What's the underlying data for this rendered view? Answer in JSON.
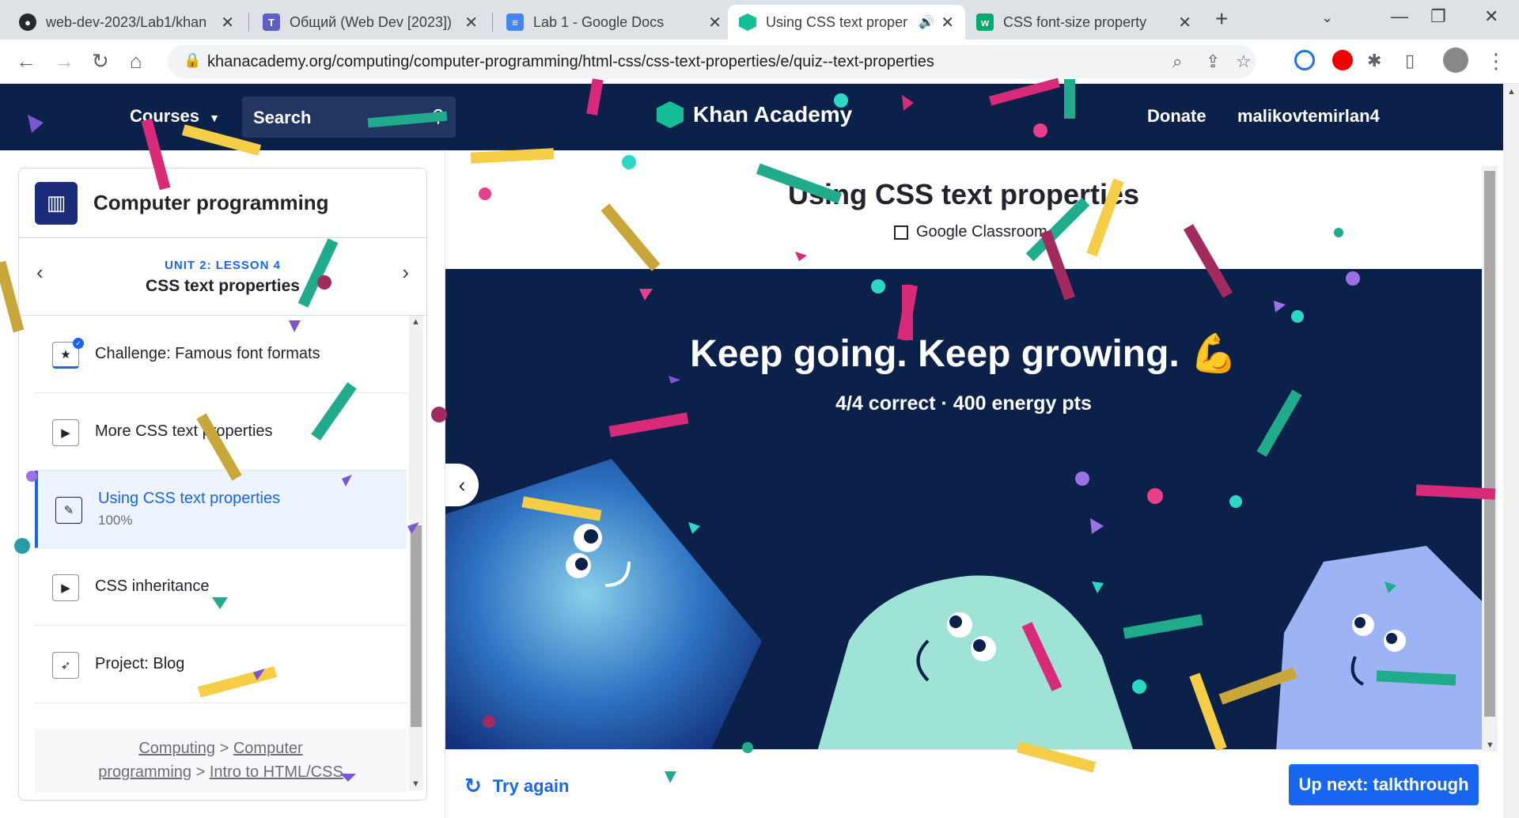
{
  "browser": {
    "tabs": [
      {
        "title": "web-dev-2023/Lab1/khan",
        "icon": "github-icon"
      },
      {
        "title": "Общий (Web Dev [2023])",
        "icon": "teams-icon"
      },
      {
        "title": "Lab 1 - Google Docs",
        "icon": "docs-icon"
      },
      {
        "title": "Using CSS text proper",
        "icon": "khan-icon",
        "active": true
      },
      {
        "title": "CSS font-size property",
        "icon": "w3schools-icon"
      }
    ],
    "url": "khanacademy.org/computing/computer-programming/html-css/css-text-properties/e/quiz--text-properties"
  },
  "header": {
    "courses_label": "Courses",
    "search_label": "Search",
    "logo_text": "Khan Academy",
    "donate_label": "Donate",
    "username": "malikovtemirlan4"
  },
  "sidebar": {
    "course_title": "Computer programming",
    "unit_label": "UNIT 2: LESSON 4",
    "lesson_title": "CSS text properties",
    "items": [
      {
        "label": "Challenge: Famous font formats",
        "type": "challenge",
        "completed": true
      },
      {
        "label": "More CSS text properties",
        "type": "video"
      },
      {
        "label": "Using CSS text properties",
        "type": "exercise",
        "progress": "100%",
        "active": true
      },
      {
        "label": "CSS inheritance",
        "type": "video"
      },
      {
        "label": "Project: Blog",
        "type": "project"
      }
    ],
    "breadcrumb": {
      "crumb1": "Computing",
      "sep1": ">",
      "crumb2a": "Computer",
      "crumb2b": "programming",
      "sep2": ">",
      "crumb3": "Intro to HTML/CSS"
    }
  },
  "main": {
    "title": "Using CSS text properties",
    "google_classroom": "Google Classroom",
    "result_heading": "Keep going. Keep growing.",
    "result_score": "4/4 correct · 400 energy pts",
    "try_again_label": "Try again",
    "up_next_label": "Up next: talkthrough"
  },
  "colors": {
    "ka_navy": "#0b2149",
    "ka_blue": "#1865f2",
    "ka_green": "#14bf96"
  }
}
